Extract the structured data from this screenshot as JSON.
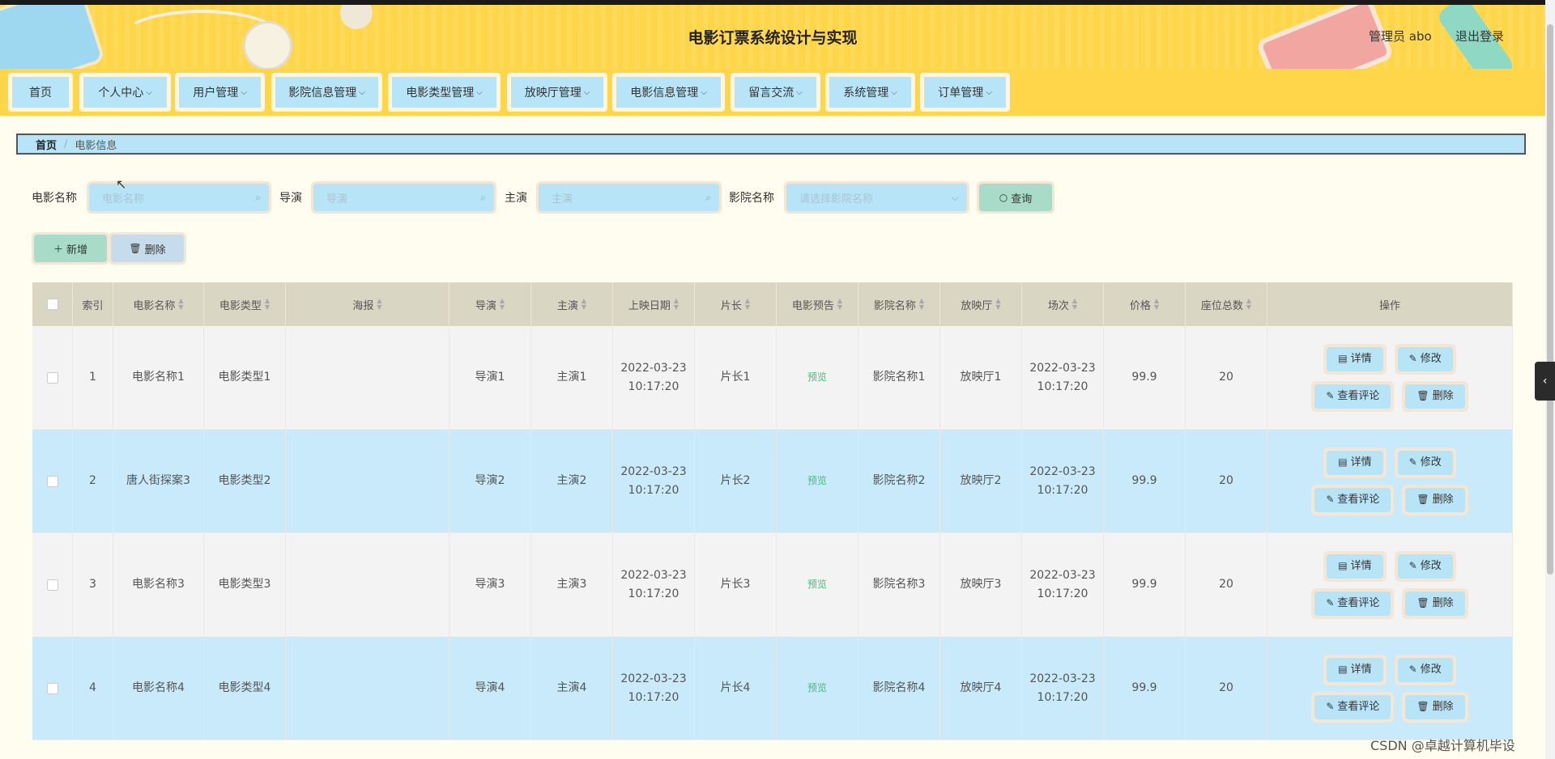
{
  "header": {
    "title": "电影订票系统设计与实现",
    "user_label": "管理员 abo",
    "logout": "退出登录"
  },
  "nav": {
    "items": [
      "首页",
      "个人中心",
      "用户管理",
      "影院信息管理",
      "电影类型管理",
      "放映厅管理",
      "电影信息管理",
      "留言交流",
      "系统管理",
      "订单管理"
    ]
  },
  "breadcrumb": {
    "home": "首页",
    "sep": "/",
    "current": "电影信息"
  },
  "search": {
    "movie_label": "电影名称",
    "movie_placeholder": "电影名称",
    "director_label": "导演",
    "director_placeholder": "导演",
    "actor_label": "主演",
    "actor_placeholder": "主演",
    "cinema_label": "影院名称",
    "cinema_placeholder": "请选择影院名称",
    "query_button": "查询"
  },
  "actions": {
    "add": "新增",
    "delete": "删除"
  },
  "table": {
    "headers": [
      "索引",
      "电影名称",
      "电影类型",
      "海报",
      "导演",
      "主演",
      "上映日期",
      "片长",
      "电影预告",
      "影院名称",
      "放映厅",
      "场次",
      "价格",
      "座位总数",
      "操作"
    ],
    "op_labels": {
      "detail": "详情",
      "edit": "修改",
      "comments": "查看评论",
      "delete": "删除"
    },
    "rows": [
      {
        "index": "1",
        "name": "电影名称1",
        "type": "电影类型1",
        "director": "导演1",
        "actor": "主演1",
        "release_date": "2022-03-23",
        "release_time": "10:17:20",
        "length": "片长1",
        "preview": "预览",
        "cinema": "影院名称1",
        "hall": "放映厅1",
        "session_date": "2022-03-23",
        "session_time": "10:17:20",
        "price": "99.9",
        "seats": "20"
      },
      {
        "index": "2",
        "name": "唐人街探案3",
        "type": "电影类型2",
        "director": "导演2",
        "actor": "主演2",
        "release_date": "2022-03-23",
        "release_time": "10:17:20",
        "length": "片长2",
        "preview": "预览",
        "cinema": "影院名称2",
        "hall": "放映厅2",
        "session_date": "2022-03-23",
        "session_time": "10:17:20",
        "price": "99.9",
        "seats": "20"
      },
      {
        "index": "3",
        "name": "电影名称3",
        "type": "电影类型3",
        "director": "导演3",
        "actor": "主演3",
        "release_date": "2022-03-23",
        "release_time": "10:17:20",
        "length": "片长3",
        "preview": "预览",
        "cinema": "影院名称3",
        "hall": "放映厅3",
        "session_date": "2022-03-23",
        "session_time": "10:17:20",
        "price": "99.9",
        "seats": "20"
      },
      {
        "index": "4",
        "name": "电影名称4",
        "type": "电影类型4",
        "director": "导演4",
        "actor": "主演4",
        "release_date": "2022-03-23",
        "release_time": "10:17:20",
        "length": "片长4",
        "preview": "预览",
        "cinema": "影院名称4",
        "hall": "放映厅4",
        "session_date": "2022-03-23",
        "session_time": "10:17:20",
        "price": "99.9",
        "seats": "20"
      }
    ]
  },
  "watermark": "CSDN @卓越计算机毕设"
}
